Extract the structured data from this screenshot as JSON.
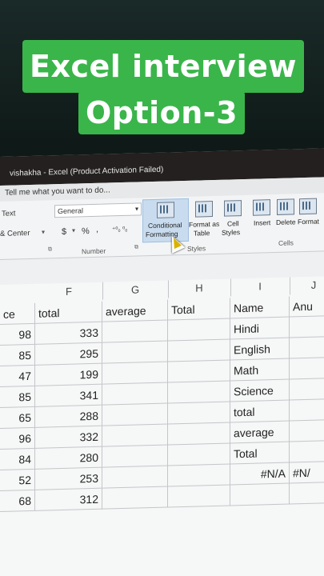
{
  "overlay": {
    "line1": "Excel interview",
    "line2": "Option-3"
  },
  "window": {
    "title": "vishakha - Excel (Product Activation Failed)"
  },
  "tell_me": "Tell me what you want to do...",
  "ribbon": {
    "alignment": {
      "wrap_text": "Text",
      "merge_center": "& Center"
    },
    "number": {
      "format_value": "General",
      "group_label": "Number",
      "currency": "$",
      "percent": "%",
      "comma": ",",
      "inc_dec": "⁺⁰₀ ⁰₀"
    },
    "styles": {
      "conditional_line1": "Conditional",
      "conditional_line2": "Formatting",
      "format_table_line1": "Format as",
      "format_table_line2": "Table",
      "cell_styles_line1": "Cell",
      "cell_styles_line2": "Styles",
      "group_label": "Styles"
    },
    "cells": {
      "insert": "Insert",
      "delete": "Delete",
      "format": "Format",
      "group_label": "Cells"
    }
  },
  "columns": [
    "F",
    "G",
    "H",
    "I",
    "J"
  ],
  "headers": [
    "ce",
    "total",
    "average",
    "Total",
    "Name",
    "Anu"
  ],
  "rows": [
    [
      "98",
      "333",
      "",
      "",
      "Hindi",
      ""
    ],
    [
      "85",
      "295",
      "",
      "",
      "English",
      ""
    ],
    [
      "47",
      "199",
      "",
      "",
      "Math",
      ""
    ],
    [
      "85",
      "341",
      "",
      "",
      "Science",
      ""
    ],
    [
      "65",
      "288",
      "",
      "",
      "total",
      ""
    ],
    [
      "96",
      "332",
      "",
      "",
      "average",
      ""
    ],
    [
      "84",
      "280",
      "",
      "",
      "Total",
      ""
    ],
    [
      "52",
      "253",
      "",
      "",
      "#N/A",
      "#N/"
    ],
    [
      "68",
      "312",
      "",
      "",
      "",
      ""
    ]
  ],
  "extra_row": [
    "",
    "",
    "",
    "",
    "#N/A",
    "#N/"
  ],
  "colors": {
    "banner": "#3ab54a",
    "titlebar": "#23201f",
    "highlight": "#c9dcef"
  }
}
